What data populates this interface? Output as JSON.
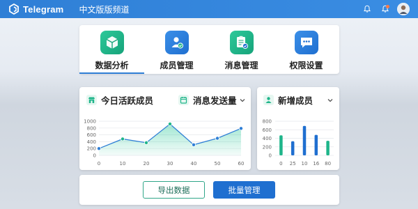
{
  "header": {
    "app_name": "Telegram",
    "title": "中文版版频道"
  },
  "menu": {
    "items": [
      {
        "label": "数据分析",
        "icon": "cube-icon",
        "color": "#1fb58a"
      },
      {
        "label": "成员管理",
        "icon": "user-check-icon",
        "color": "#2f7fd6"
      },
      {
        "label": "消息管理",
        "icon": "clipboard-check-icon",
        "color": "#1fb58a"
      },
      {
        "label": "权限设置",
        "icon": "chat-dots-icon",
        "color": "#2f7fd6"
      }
    ],
    "active_index": 0
  },
  "panel_left": {
    "title_active": "今日活跃成员",
    "title_messages": "消息发送量"
  },
  "panel_right": {
    "title": "新增成员"
  },
  "chart_data": [
    {
      "type": "area",
      "x": [
        0,
        10,
        20,
        30,
        40,
        50,
        60
      ],
      "values": [
        200,
        480,
        370,
        920,
        310,
        500,
        790
      ],
      "ylim": [
        0,
        1000
      ],
      "y_ticks": [
        0,
        200,
        400,
        600,
        800,
        1000
      ],
      "x_ticks": [
        0,
        10,
        20,
        30,
        40,
        50,
        60
      ],
      "grid": true,
      "color": "#2f7fd6",
      "marker_colors": [
        "#2f7fd6",
        "#1fb58a",
        "#1fb58a",
        "#1fb58a",
        "#2f7fd6",
        "#2f7fd6",
        "#2f7fd6"
      ]
    },
    {
      "type": "bar",
      "categories": [
        "0",
        "25",
        "10",
        "16",
        "80"
      ],
      "values": [
        470,
        330,
        690,
        480,
        340
      ],
      "ylim": [
        0,
        800
      ],
      "y_ticks": [
        0,
        200,
        400,
        600,
        800
      ],
      "grid": true,
      "colors": [
        "#1fb58a",
        "#1f6fd0",
        "#1f6fd0",
        "#1f6fd0",
        "#1fb58a"
      ]
    }
  ],
  "actions": {
    "export_label": "导出数据",
    "batch_label": "批量管理"
  }
}
